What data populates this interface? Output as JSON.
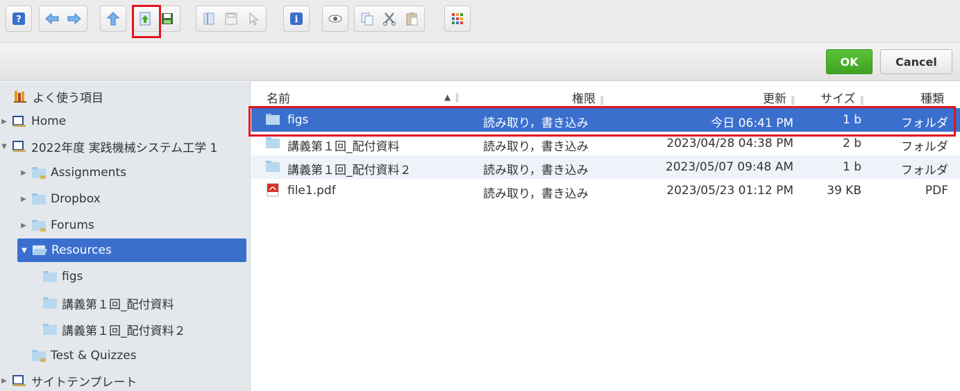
{
  "toolbar": {
    "groups": [
      {
        "icons": [
          "help-icon"
        ]
      },
      {
        "icons": [
          "back-icon",
          "forward-icon"
        ]
      },
      {
        "icons": [
          "up-icon"
        ]
      },
      {
        "icons": [
          "upload-icon",
          "save-icon"
        ]
      },
      {
        "icons": [
          "new-document-icon",
          "new-folder-icon",
          "select-icon"
        ]
      },
      {
        "icons": [
          "info-icon"
        ]
      },
      {
        "icons": [
          "preview-icon"
        ]
      },
      {
        "icons": [
          "copy-icon",
          "cut-icon",
          "paste-icon"
        ]
      },
      {
        "icons": [
          "grid-view-icon"
        ]
      }
    ],
    "highlighted": "upload-icon"
  },
  "actions": {
    "ok_label": "OK",
    "cancel_label": "Cancel"
  },
  "sidebar": {
    "favorites_label": "よく使う項目",
    "home_label": "Home",
    "course_label": "2022年度 実践機械システム工学 1",
    "assignments_label": "Assignments",
    "dropbox_label": "Dropbox",
    "forums_label": "Forums",
    "resources_label": "Resources",
    "figs_label": "figs",
    "handout1_label": "講義第１回_配付資料",
    "handout2_label": "講義第１回_配付資料２",
    "tests_label": "Test & Quizzes",
    "templates_label": "サイトテンプレート"
  },
  "columns": {
    "name": "名前",
    "permission": "権限",
    "modified": "更新",
    "size": "サイズ",
    "kind": "種類"
  },
  "files": [
    {
      "name": "figs",
      "permission": "読み取り，書き込み",
      "modified": "今日 06:41 PM",
      "size": "1 b",
      "kind": "フォルダ"
    },
    {
      "name": "講義第１回_配付資料",
      "permission": "読み取り，書き込み",
      "modified": "2023/04/28 04:38 PM",
      "size": "2 b",
      "kind": "フォルダ"
    },
    {
      "name": "講義第１回_配付資料２",
      "permission": "読み取り，書き込み",
      "modified": "2023/05/07 09:48 AM",
      "size": "1 b",
      "kind": "フォルダ"
    },
    {
      "name": "file1.pdf",
      "permission": "読み取り，書き込み",
      "modified": "2023/05/23 01:12 PM",
      "size": "39 KB",
      "kind": "PDF"
    }
  ],
  "colors": {
    "selection": "#3a6fce",
    "highlight_outline": "#e0141e",
    "ok_green": "#46a827"
  }
}
